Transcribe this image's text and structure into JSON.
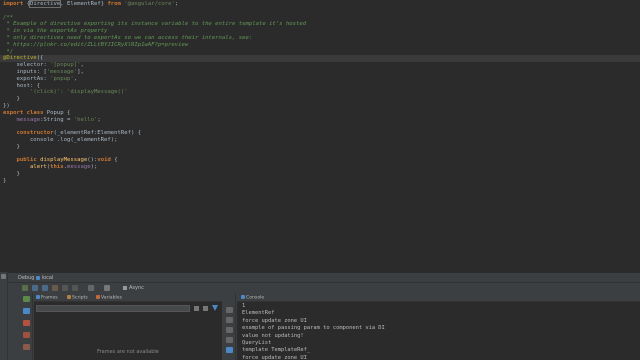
{
  "editor": {
    "lines": [
      {
        "type": "import",
        "kw1": "import",
        "p1": " {",
        "sel": "Directive",
        "p2": ", ElementRef} ",
        "kw2": "from",
        "p3": " ",
        "str": "'@angular/core'",
        "p4": ";"
      },
      {
        "type": "blank"
      },
      {
        "type": "comment",
        "text": "/**"
      },
      {
        "type": "comment",
        "text": " * Example of directive exporting its instance variable to the entire template it's hosted"
      },
      {
        "type": "comment",
        "text": " * in via the exportAs property"
      },
      {
        "type": "comment",
        "text": " * only directives need to exportAs so we can access their internals, see:"
      },
      {
        "type": "comment",
        "text": " * https://plnkr.co/edit/ZLLtBYJICRyXlRIp1wAF?p=preview"
      },
      {
        "type": "comment",
        "text": " */"
      },
      {
        "type": "decorator",
        "text": "@Directive",
        "p": "({"
      },
      {
        "type": "prop",
        "indent": "    ",
        "key": "selector",
        "p": ": ",
        "str": "'[popup]'",
        "end": ","
      },
      {
        "type": "prop",
        "indent": "    ",
        "key": "inputs",
        "p": ": [",
        "str": "'message'",
        "end": "],"
      },
      {
        "type": "prop",
        "indent": "    ",
        "key": "exportAs",
        "p": ": ",
        "str": "'popup'",
        "end": ","
      },
      {
        "type": "plain",
        "text": "    host: {"
      },
      {
        "type": "prop",
        "indent": "        ",
        "key": "",
        "p": "",
        "str": "'(click)': 'displayMessage()'",
        "end": ""
      },
      {
        "type": "plain",
        "text": "    }"
      },
      {
        "type": "plain",
        "text": "})"
      },
      {
        "type": "class",
        "kw1": "export",
        "kw2": "class",
        "name": " Popup {"
      },
      {
        "type": "field",
        "indent": "    ",
        "name": "message",
        "p": ":String = ",
        "str": "'hello'",
        "end": ";"
      },
      {
        "type": "blank"
      },
      {
        "type": "ctor",
        "indent": "    ",
        "kw": "constructor",
        "rest": "(_elementRef:ElementRef) {"
      },
      {
        "type": "plain",
        "text": "        console .log(_elementRef);"
      },
      {
        "type": "plain",
        "text": "    }"
      },
      {
        "type": "blank"
      },
      {
        "type": "method",
        "indent": "    ",
        "kw1": "public",
        "fn": " displayMessage",
        "p": "():",
        "kw2": "void",
        "end": " {"
      },
      {
        "type": "alert",
        "indent": "        ",
        "fn": "alert",
        "p1": "(",
        "kw": "this",
        "p2": ".",
        "fld": "message",
        "end": ");"
      },
      {
        "type": "plain",
        "text": "    }"
      },
      {
        "type": "plain",
        "text": "}"
      }
    ]
  },
  "debug": {
    "tab_label": "Debug",
    "tab_name": "local",
    "async_label": "Async",
    "frames_tab": "Frames",
    "scripts_tab": "Scripts",
    "variables_tab": "Variables",
    "console_tab": "Console",
    "frames_empty": "Frames are not available",
    "console_lines": [
      "1",
      "ElementRef",
      "force update zone UI",
      "example of passing param to component via DI",
      "value not updating!",
      "QueryList",
      "template TemplateRef_",
      "force update zone UI"
    ]
  },
  "colors": {
    "editor_bg": "#2b2b2b",
    "panel_bg": "#3c3f41",
    "keyword": "#cc7832",
    "string": "#6a8759",
    "comment": "#629755",
    "annotation": "#bbb529"
  }
}
